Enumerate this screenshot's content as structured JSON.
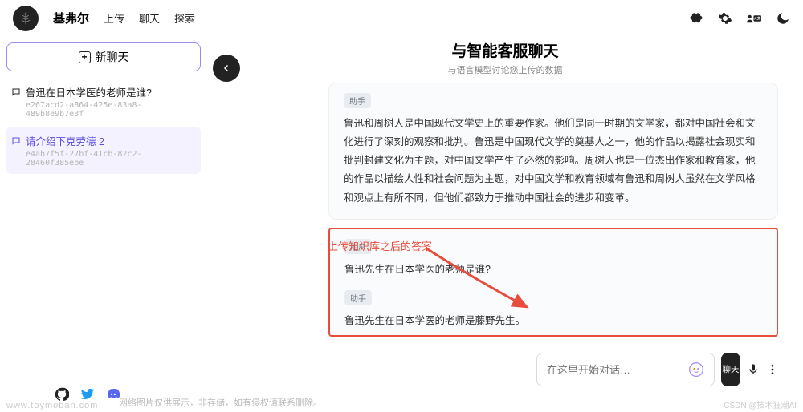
{
  "brand": "基弗尔",
  "nav": {
    "upload": "上传",
    "chat": "聊天",
    "explore": "探索"
  },
  "sidebar": {
    "new_chat": "新聊天",
    "items": [
      {
        "title": "鲁迅在日本学医的老师是谁?",
        "id": "e267acd2-a864-425e-83a8-489b8e9b7e3f"
      },
      {
        "title": "请介绍下克劳德 2",
        "id": "e4ab7f5f-27bf-41cb-82c2-28460f385ebe"
      }
    ]
  },
  "chat": {
    "title": "与智能客服聊天",
    "subtitle": "与语言模型讨论您上传的数据",
    "messages": [
      {
        "role_label": "助手",
        "text": "鲁迅和周树人是中国现代文学史上的重要作家。他们是同一时期的文学家，都对中国社会和文化进行了深刻的观察和批判。鲁迅是中国现代文学的奠基人之一，他的作品以揭露社会现实和批判封建文化为主题，对中国文学产生了必然的影响。周树人也是一位杰出作家和教育家，他的作品以描绘人性和社会问题为主题，对中国文学和教育领域有鲁迅和周树人虽然在文学风格和观点上有所不同，但他们都致力于推动中国社会的进步和变革。"
      },
      {
        "role_label": "用户",
        "text": "鲁迅先生在日本学医的老师是谁?"
      },
      {
        "role_label": "助手",
        "text": "鲁迅先生在日本学医的老师是藤野先生。"
      }
    ],
    "input_placeholder": "在这里开始对话…",
    "send_label": "聊天"
  },
  "annotation": "上传知识库之后的答案",
  "footer": {
    "note": "网络图片仅供展示，非存储，如有侵权请联系删除。",
    "watermark_left": "www.toymoban.com",
    "watermark_right": "CSDN @技术狂潮AI"
  }
}
